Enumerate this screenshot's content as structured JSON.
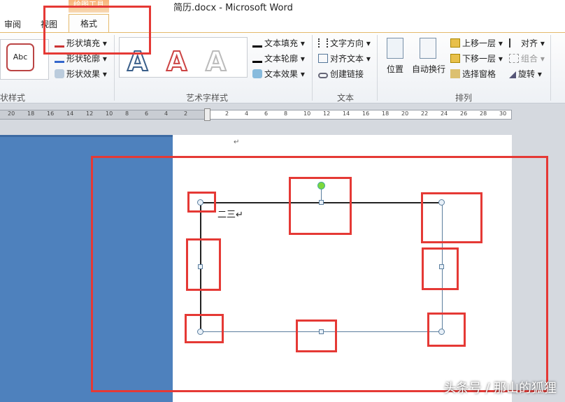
{
  "window": {
    "title": "简历.docx  -  Microsoft Word",
    "context_tab": "绘图工具"
  },
  "tabs": [
    "审阅",
    "视图",
    "格式"
  ],
  "ribbon": {
    "shape_styles": {
      "label": "状样式",
      "sample": "Abc",
      "fill": "形状填充",
      "outline": "形状轮廓",
      "effects": "形状效果"
    },
    "wordart": {
      "label": "艺术字样式",
      "sample": "A",
      "fill": "文本填充",
      "outline": "文本轮廓",
      "effects": "文本效果"
    },
    "text": {
      "label": "文本",
      "direction": "文字方向",
      "align": "对齐文本",
      "link": "创建链接"
    },
    "arrange": {
      "label": "排列",
      "position": "位置",
      "wrap": "自动换行",
      "forward": "上移一层",
      "backward": "下移一层",
      "pane": "选择窗格",
      "align": "对齐",
      "group": "组合",
      "rotate": "旋转"
    }
  },
  "ruler": {
    "left": [
      "20",
      "18",
      "16",
      "14",
      "12",
      "10",
      "8",
      "6",
      "4",
      "2"
    ],
    "right": [
      "2",
      "4",
      "6",
      "8",
      "10",
      "12",
      "14",
      "16",
      "18",
      "20",
      "22",
      "24",
      "26",
      "28",
      "30"
    ]
  },
  "document": {
    "para_mark": "↵",
    "text": "二三↵"
  },
  "watermark": "头条号 / 那山的狐狸",
  "colors": {
    "accent": "#e53935",
    "blue": "#4e81bd"
  }
}
